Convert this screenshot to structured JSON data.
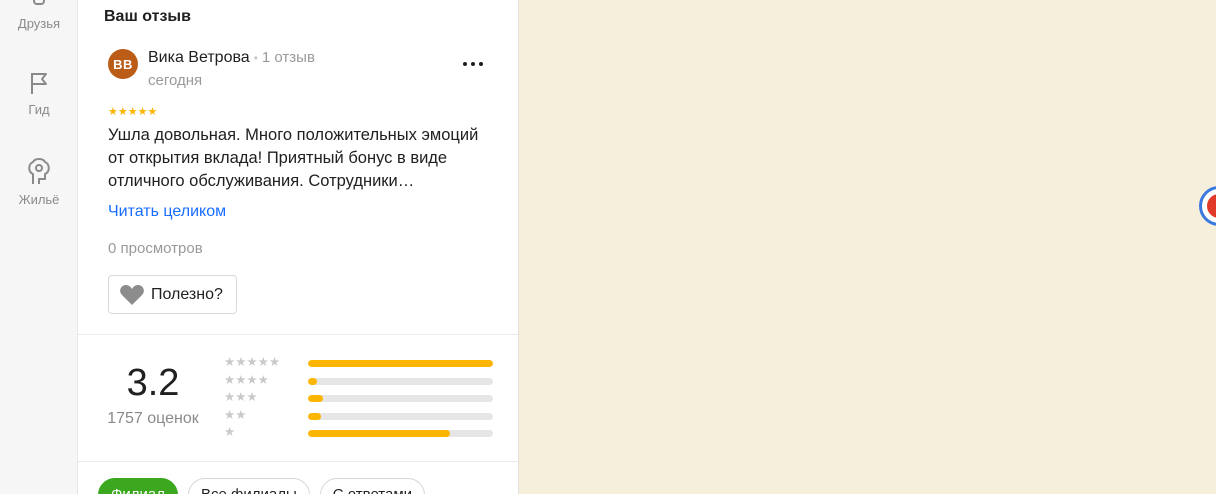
{
  "rail": {
    "items": [
      {
        "label": "Друзья",
        "icon": "friends-icon"
      },
      {
        "label": "Гид",
        "icon": "flag-icon"
      },
      {
        "label": "Жильё",
        "icon": "housing-icon"
      }
    ]
  },
  "review": {
    "section_title": "Ваш отзыв",
    "avatar_initials": "ВВ",
    "author": "Вика Ветрова",
    "separator": "•",
    "review_count": "1 отзыв",
    "date": "сегодня",
    "stars": "★★★★★",
    "rating": 5,
    "text": "Ушла довольная. Много положительных эмоций от открытия вклада! Приятный бонус в виде отличного обслуживания. Сотрудники…",
    "read_more": "Читать целиком",
    "views": "0 просмотров",
    "useful_label": "Полезно?"
  },
  "summary": {
    "average": "3.2",
    "ratings_count": "1757 оценок",
    "distribution": [
      {
        "stars": "★★★★★",
        "fraction": 1.0
      },
      {
        "stars": "★★★★",
        "fraction": 0.05
      },
      {
        "stars": "★★★",
        "fraction": 0.08
      },
      {
        "stars": "★★",
        "fraction": 0.07
      },
      {
        "stars": "★",
        "fraction": 0.77
      }
    ]
  },
  "filters": {
    "chips": [
      {
        "label": "Филиал",
        "active": true
      },
      {
        "label": "Все филиалы",
        "active": false
      },
      {
        "label": "С ответами",
        "active": false
      }
    ]
  },
  "colors": {
    "accent_link": "#196dff",
    "star": "#fcb500",
    "active_chip": "#3ba820",
    "avatar": "#bb5d17",
    "map_background": "#f5efdc"
  }
}
